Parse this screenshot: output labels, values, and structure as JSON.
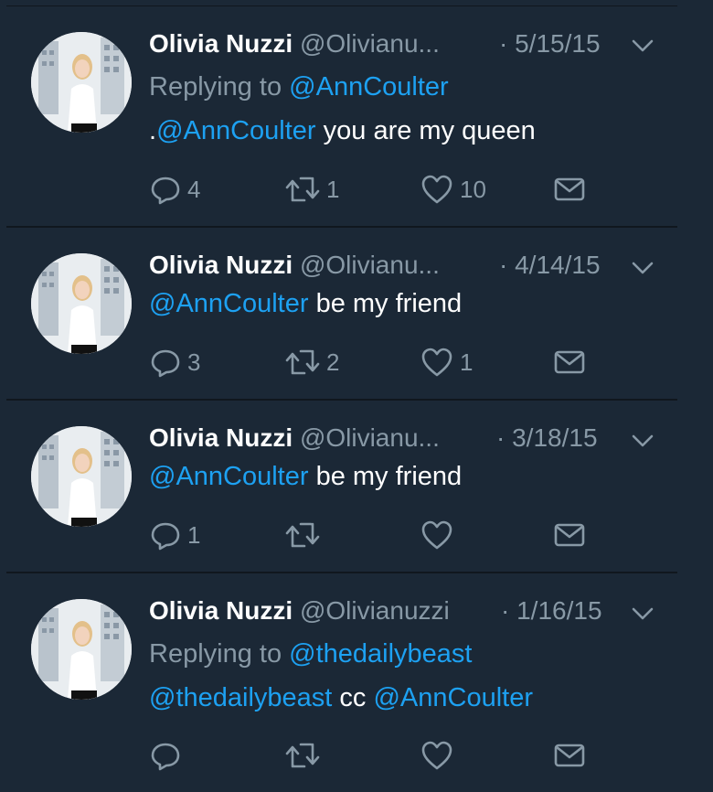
{
  "tweets": [
    {
      "name": "Olivia Nuzzi",
      "handle": "@Olivianu...",
      "date": "· 5/15/15",
      "reply_prefix": "Replying to ",
      "reply_to": "@AnnCoulter",
      "text_pre": ".",
      "text_mention": "@AnnCoulter",
      "text_rest": " you are my queen",
      "replies": "4",
      "retweets": "1",
      "likes": "10"
    },
    {
      "name": "Olivia Nuzzi",
      "handle": "@Olivianu...",
      "date": "· 4/14/15",
      "text_mention": "@AnnCoulter",
      "text_rest": " be my friend",
      "replies": "3",
      "retweets": "2",
      "likes": "1"
    },
    {
      "name": "Olivia Nuzzi",
      "handle": "@Olivianu...",
      "date": "· 3/18/15",
      "text_mention": "@AnnCoulter",
      "text_rest": " be my friend",
      "replies": "1",
      "retweets": "",
      "likes": ""
    },
    {
      "name": "Olivia Nuzzi",
      "handle": "@Olivianuzzi",
      "date": "· 1/16/15",
      "reply_prefix": "Replying to ",
      "reply_to": "@thedailybeast",
      "text_mention": "@thedailybeast",
      "text_rest": " cc ",
      "text_mention2": "@AnnCoulter",
      "replies": "",
      "retweets": "",
      "likes": ""
    }
  ],
  "colors": {
    "background": "#1b2836",
    "divider": "#10171e",
    "link": "#1da1f2",
    "muted": "#8899a6"
  },
  "icons": [
    "reply-icon",
    "retweet-icon",
    "like-icon",
    "message-icon",
    "chevron-down-icon",
    "avatar"
  ]
}
